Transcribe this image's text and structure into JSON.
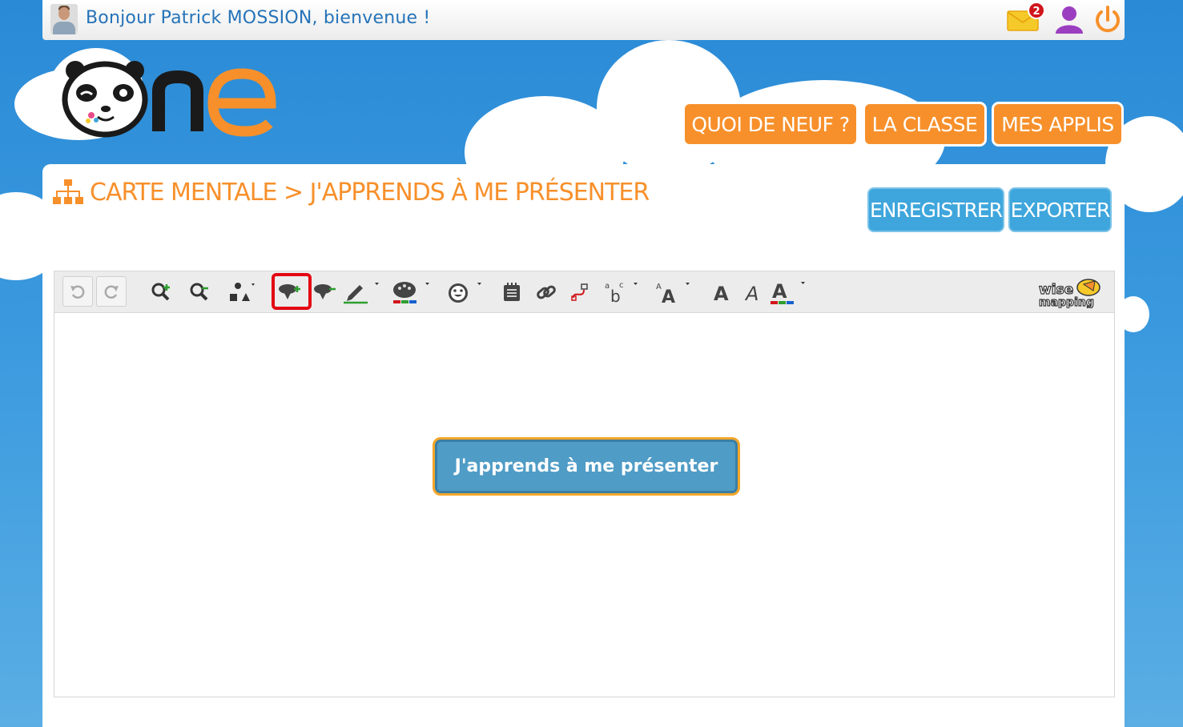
{
  "header": {
    "welcome": "Bonjour Patrick MOSSION, bienvenue !",
    "mail_count": "2",
    "icons": [
      "mail-icon",
      "user-icon",
      "power-icon"
    ]
  },
  "logo": {
    "text": "one"
  },
  "nav": {
    "items": [
      {
        "label": "QUOI DE NEUF ?"
      },
      {
        "label": "LA CLASSE"
      },
      {
        "label": "MES APPLIS"
      }
    ]
  },
  "page": {
    "title": "CARTE MENTALE > J'APPRENDS À ME PRÉSENTER",
    "save_label": "ENREGISTRER",
    "export_label": "EXPORTER"
  },
  "toolbar": {
    "tools": [
      "undo-icon",
      "redo-icon",
      "zoom-in-icon",
      "zoom-out-icon",
      "shape-icon",
      "add-topic-icon",
      "delete-topic-icon",
      "border-color-icon",
      "fill-color-icon",
      "emoji-icon",
      "note-icon",
      "link-icon",
      "relationship-icon",
      "font-family-icon",
      "font-size-icon",
      "bold-icon",
      "italic-icon",
      "font-color-icon"
    ],
    "brand": "wise mapping"
  },
  "mindmap": {
    "central_topic": "J'apprends à me présenter"
  },
  "colors": {
    "orange": "#f7902b",
    "blue": "#3ea6dc",
    "node_fill": "#4f9cc6",
    "node_border": "#f4a62a",
    "highlight": "#e30613"
  }
}
